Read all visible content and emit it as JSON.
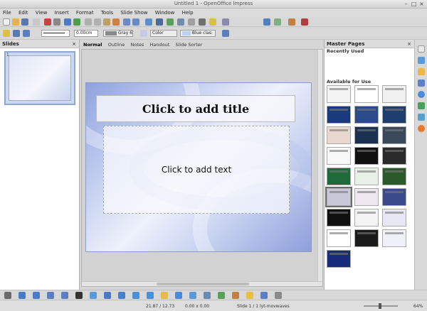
{
  "window": {
    "title": "Untitled 1 - OpenOffice Impress"
  },
  "menu": [
    "File",
    "Edit",
    "View",
    "Insert",
    "Format",
    "Tools",
    "Slide Show",
    "Window",
    "Help"
  ],
  "line_toolbar": {
    "line_width": "0.00cm",
    "area_color_name": "Gray 6",
    "area_style": "Color",
    "fill_color_name": "Blue clas:"
  },
  "slides_panel": {
    "header": "Slides",
    "close": "×",
    "thumbnail_number": "1"
  },
  "view_tabs": [
    {
      "label": "Normal",
      "active": true
    },
    {
      "label": "Outline",
      "active": false
    },
    {
      "label": "Notes",
      "active": false
    },
    {
      "label": "Handout",
      "active": false
    },
    {
      "label": "Slide Sorter",
      "active": false
    }
  ],
  "slide": {
    "title_placeholder": "Click to add title",
    "content_placeholder": "Click to add text"
  },
  "master_panel": {
    "header": "Master Pages",
    "close": "×",
    "recently_used": "Recently Used",
    "available": "Available for Use"
  },
  "status": {
    "position": "21.87 / 12.73",
    "size": "0.00 x 0.00",
    "slide_num": "Slide 1 / 1",
    "master": "lyt-movwaves",
    "zoom": "64%"
  },
  "colors": {
    "accent": "#8fa7d1",
    "slide_blue": "#8fa2de"
  }
}
